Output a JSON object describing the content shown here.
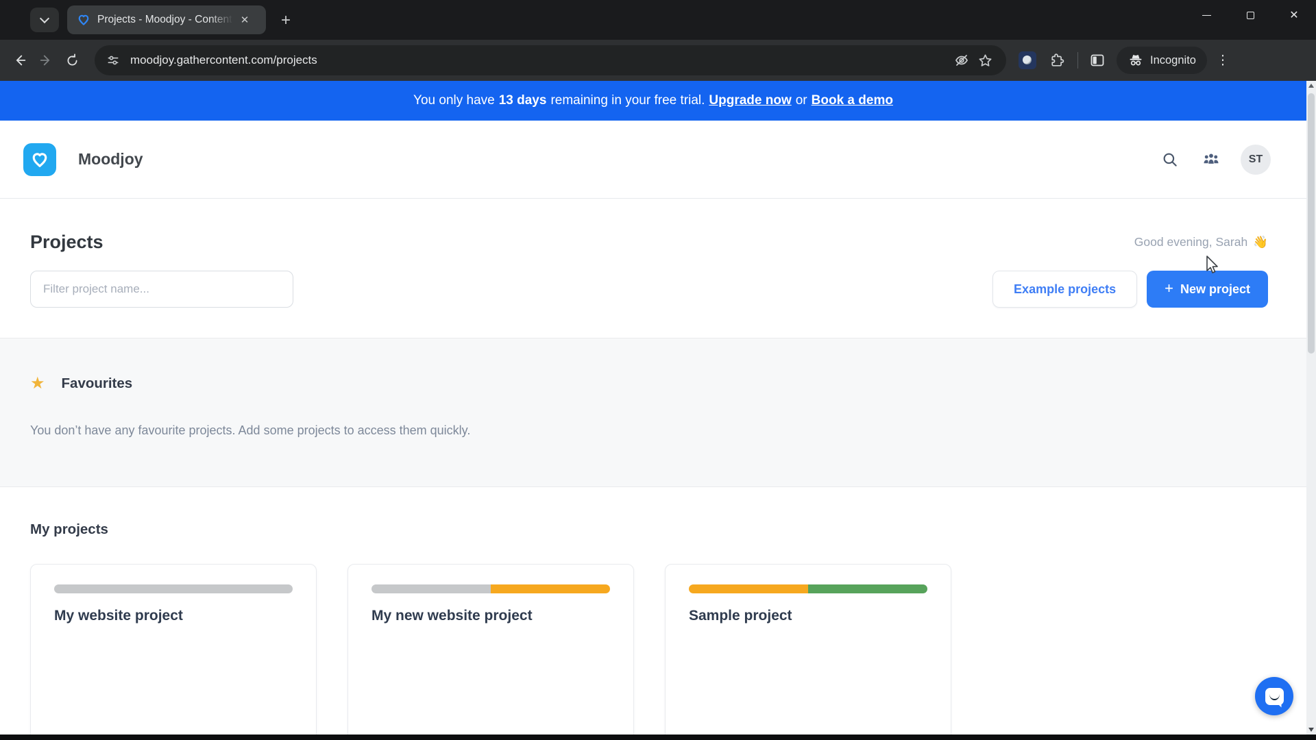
{
  "browser": {
    "tab_title": "Projects - Moodjoy - Content W",
    "url": "moodjoy.gathercontent.com/projects",
    "incognito_label": "Incognito",
    "new_tab_label": "+",
    "kebab_glyph": "⋮",
    "close_tab_glyph": "✕",
    "close_window_glyph": "✕"
  },
  "banner": {
    "prefix": "You only have",
    "days": "13 days",
    "middle": "remaining in your free trial.",
    "upgrade_link": "Upgrade now",
    "or_text": "or",
    "demo_link": "Book a demo"
  },
  "header": {
    "brand": "Moodjoy",
    "avatar_initials": "ST"
  },
  "page": {
    "title": "Projects",
    "greeting": "Good evening, Sarah",
    "greeting_emoji": "👋",
    "filter_placeholder": "Filter project name...",
    "example_button": "Example projects",
    "new_project_plus": "+",
    "new_project_label": "New project",
    "favourites_star": "★",
    "favourites_title": "Favourites",
    "favourites_empty": "You don’t have any favourite projects. Add some projects to access them quickly.",
    "my_projects_title": "My projects",
    "cards": [
      {
        "name": "My website project",
        "segments": [
          {
            "color": "#c6c8ca",
            "pct": 100
          }
        ]
      },
      {
        "name": "My new website project",
        "segments": [
          {
            "color": "#c6c8ca",
            "pct": 50
          },
          {
            "color": "#f6a81f",
            "pct": 50
          }
        ]
      },
      {
        "name": "Sample project",
        "segments": [
          {
            "color": "#f6a81f",
            "pct": 50
          },
          {
            "color": "#57a35b",
            "pct": 50
          }
        ]
      }
    ]
  },
  "colors": {
    "banner_bg": "#1464f0",
    "primary_button_blue": "#2d7cf6",
    "logo_blue": "#21a8f0",
    "chat_fab_blue": "#1f6ff2",
    "progress_gray": "#c6c8ca",
    "progress_orange": "#f6a81f",
    "progress_green": "#57a35b",
    "favourite_star_yellow": "#f1b43a"
  }
}
